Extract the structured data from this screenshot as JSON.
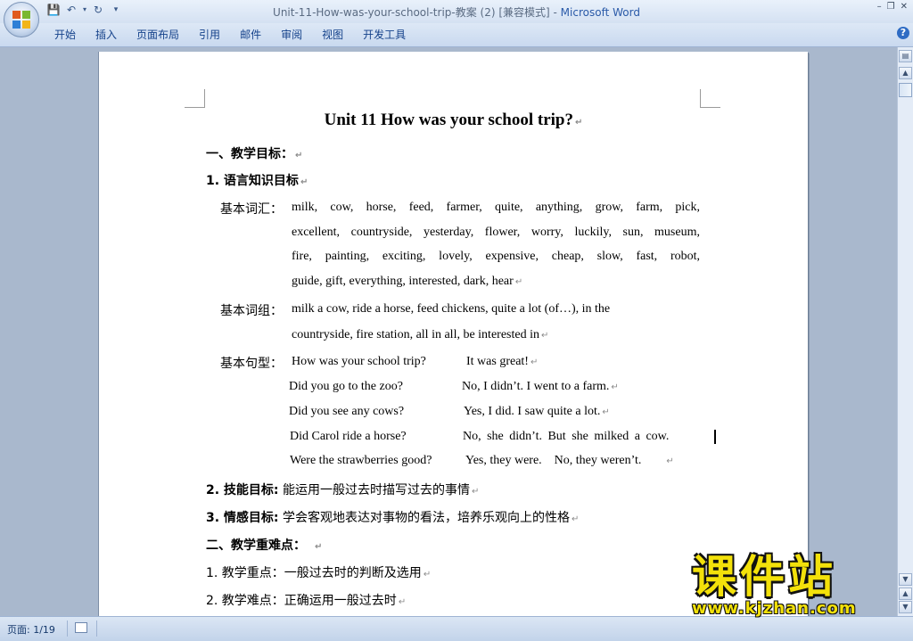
{
  "window": {
    "title": "Unit-11-How-was-your-school-trip-教案 (2) [兼容模式] - ",
    "app_name": "Microsoft Word"
  },
  "ribbon": {
    "tabs": [
      "开始",
      "插入",
      "页面布局",
      "引用",
      "邮件",
      "审阅",
      "视图",
      "开发工具"
    ]
  },
  "document": {
    "title": "Unit 11 How was your school trip?",
    "sections": {
      "s1_heading": "一、教学目标：",
      "s1_1": "1. 语言知识目标",
      "vocab_label": "基本词汇：",
      "vocab_lines": [
        "milk, cow, horse, feed, farmer, quite, anything, grow, farm, pick,",
        "excellent, countryside, yesterday, flower, worry, luckily, sun, museum,",
        "fire, painting, exciting, lovely, expensive, cheap, slow, fast, robot,",
        "guide, gift, everything, interested, dark, hear"
      ],
      "phrase_label": "基本词组：",
      "phrase_lines": [
        "milk a cow, ride a horse, feed chickens, quite a lot (of…), in the",
        "countryside, fire station, all in all, be interested in"
      ],
      "sentence_label": "基本句型：",
      "sentences": [
        {
          "q": "How was your school trip?",
          "a": "It was great!"
        },
        {
          "q": "Did you go to the zoo?",
          "a": "No, I didn’t. I went to a farm."
        },
        {
          "q": "Did you see any cows?",
          "a": "Yes, I did. I saw quite a lot."
        },
        {
          "q": "Did Carol ride a horse?",
          "a": "No, she didn’t. But she milked a cow."
        },
        {
          "q": "Were the strawberries good?",
          "a": "Yes, they were.    No, they weren’t."
        }
      ],
      "s1_2_num": "2. 技能目标:",
      "s1_2_text": " 能运用一般过去时描写过去的事情",
      "s1_3_num": "3. 情感目标:",
      "s1_3_text": " 学会客观地表达对事物的看法，培养乐观向上的性格",
      "s2_heading": "二、教学重难点：",
      "s2_1": "1. 教学重点：一般过去时的判断及选用",
      "s2_2": "2. 教学难点：正确运用一般过去时"
    }
  },
  "statusbar": {
    "page": "页面: 1/19"
  },
  "watermark": {
    "logo_text": "课件站",
    "url": "www.kjzhan.com"
  },
  "icons": {
    "office_button": "office-logo-icon",
    "save": "save-icon",
    "undo": "undo-icon",
    "redo": "redo-icon",
    "help": "help-icon"
  }
}
